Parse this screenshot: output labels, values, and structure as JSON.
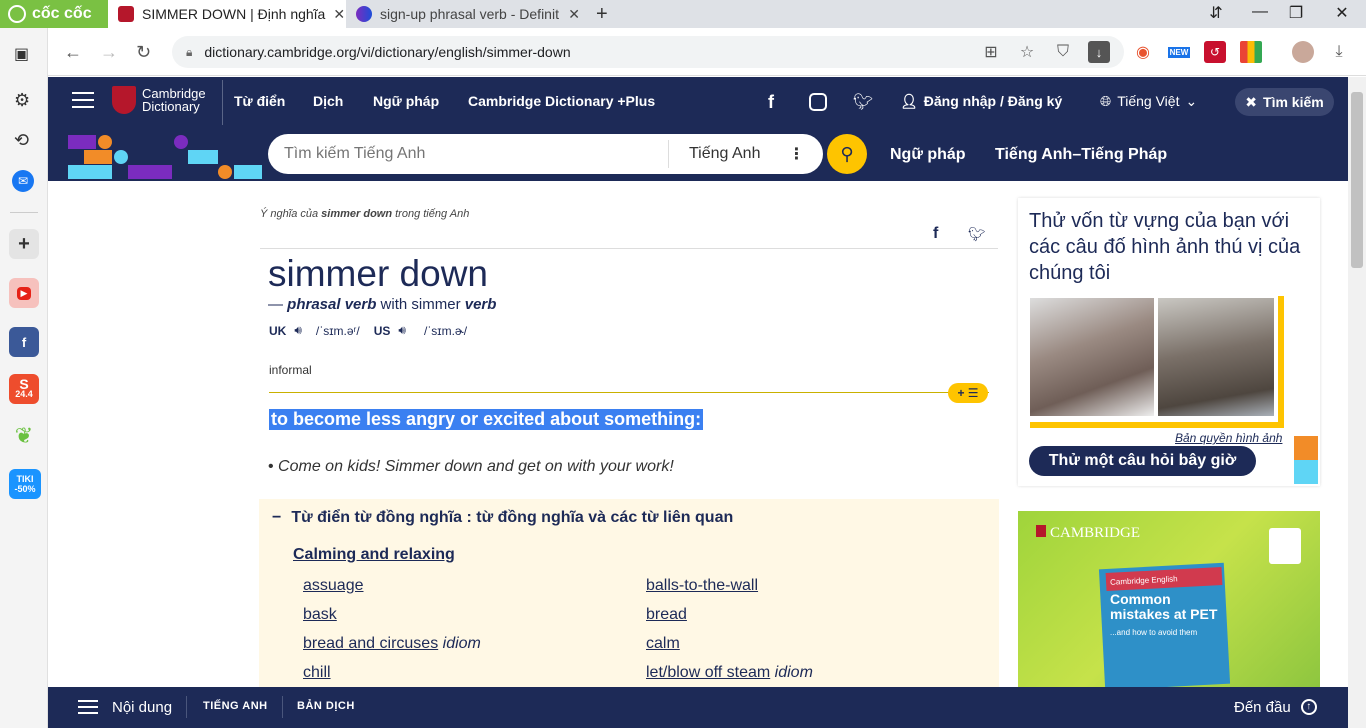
{
  "browser": {
    "brand": "cốc cốc",
    "tabs": [
      {
        "title": "SIMMER DOWN | Định nghĩa",
        "active": true
      },
      {
        "title": "sign-up phrasal verb - Definit",
        "active": false
      }
    ],
    "url": "dictionary.cambridge.org/vi/dictionary/english/simmer-down",
    "badge_new": "NEW",
    "sidebar": [
      {
        "icon": "youtube-icon"
      },
      {
        "icon": "facebook-icon"
      },
      {
        "icon": "shopee-icon",
        "text": "24.4"
      },
      {
        "icon": "tiki-icon",
        "text": "TIKI -50%"
      }
    ]
  },
  "site": {
    "logo_line1": "Cambridge",
    "logo_line2": "Dictionary",
    "nav": [
      "Từ điển",
      "Dịch",
      "Ngữ pháp",
      "Cambridge Dictionary +Plus"
    ],
    "login": "Đăng nhập / Đăng ký",
    "language": "Tiếng Việt",
    "search_button": "Tìm kiếm",
    "search_placeholder": "Tìm kiếm Tiếng Anh",
    "search_lang": "Tiếng Anh",
    "sub_links": [
      "Ngữ pháp",
      "Tiếng Anh–Tiếng Pháp"
    ]
  },
  "entry": {
    "crumb_pre": "Ý nghĩa của ",
    "crumb_word": "simmer down",
    "crumb_post": " trong tiếng Anh",
    "headword": "simmer down",
    "pos_dash": "— ",
    "pos": "phrasal verb",
    "pos_with": " with simmer ",
    "pos_verb": "verb",
    "uk": "UK",
    "uk_ipa": "/ˈsɪm.əʳ/",
    "us": "US",
    "us_ipa": "/ˈsɪm.ɚ/",
    "usage": "informal",
    "definition": "to become less angry or excited about something:",
    "example": "Come on kids! Simmer down and get on with your work!",
    "synonyms_title": "Từ điển từ đồng nghĩa : từ đồng nghĩa và các từ liên quan",
    "synonyms_group": "Calming and relaxing",
    "synonyms_left": [
      {
        "word": "assuage",
        "tag": ""
      },
      {
        "word": "bask",
        "tag": ""
      },
      {
        "word": "bread and circuses",
        "tag": "idiom"
      },
      {
        "word": "chill",
        "tag": ""
      }
    ],
    "synonyms_right": [
      {
        "word": "balls-to-the-wall",
        "tag": ""
      },
      {
        "word": "bread",
        "tag": ""
      },
      {
        "word": "calm",
        "tag": ""
      },
      {
        "word": "let/blow off steam",
        "tag": "idiom"
      }
    ]
  },
  "aside": {
    "quiz_text": "Thử vốn từ vựng của bạn với các câu đố hình ảnh thú vị của chúng tôi",
    "copyright": "Bản quyền hình ảnh",
    "quiz_button": "Thử một câu hỏi bây giờ",
    "ad_brand": "CAMBRIDGE",
    "ad_book_series": "Cambridge English",
    "ad_book_title": "Common mistakes at PET",
    "ad_book_sub": "...and how to avoid them"
  },
  "bottom": {
    "contents": "Nội dung",
    "english": "TIẾNG ANH",
    "translation": "BẢN DỊCH",
    "top": "Đến đầu"
  },
  "colors": {
    "navy": "#1d2a57",
    "yellow": "#fec400",
    "highlight": "#3b80f1",
    "browser_green": "#7ac143"
  }
}
